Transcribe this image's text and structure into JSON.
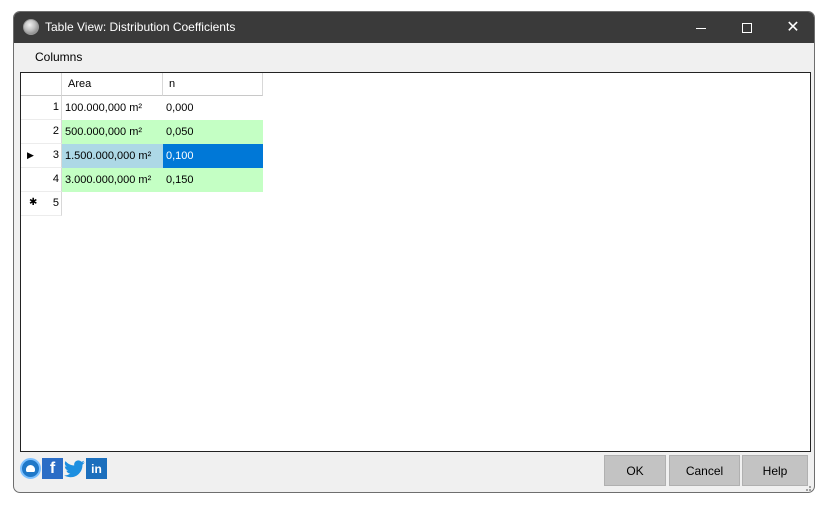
{
  "window": {
    "title": "Table View: Distribution Coefficients",
    "controls": {
      "minimize": "—",
      "maximize": "☐",
      "close": "✕"
    }
  },
  "menu": {
    "columns_label": "Columns"
  },
  "grid": {
    "columns": [
      "Area",
      "n"
    ],
    "rows": [
      {
        "num": "1",
        "area": "100.000,000 m²",
        "n": "0,000",
        "state": "normal"
      },
      {
        "num": "2",
        "area": "500.000,000 m²",
        "n": "0,050",
        "state": "green"
      },
      {
        "num": "3",
        "area": "1.500.000,000 m²",
        "n": "0,100",
        "state": "selected",
        "marker": "▶"
      },
      {
        "num": "4",
        "area": "3.000.000,000 m²",
        "n": "0,150",
        "state": "green"
      },
      {
        "num": "5",
        "area": "",
        "n": "",
        "state": "new",
        "marker": "✱"
      }
    ]
  },
  "footer": {
    "social_icons": [
      "app-logo-icon",
      "facebook-icon",
      "twitter-icon",
      "linkedin-icon"
    ],
    "facebook_glyph": "f",
    "linkedin_glyph": "in",
    "ok_label": "OK",
    "cancel_label": "Cancel",
    "help_label": "Help"
  },
  "colors": {
    "titlebar": "#3a3a3a",
    "valid_row": "#c4ffc4",
    "selected_cell": "#0078d7",
    "selected_row": "#add8e6",
    "button": "#c3c3c3"
  }
}
